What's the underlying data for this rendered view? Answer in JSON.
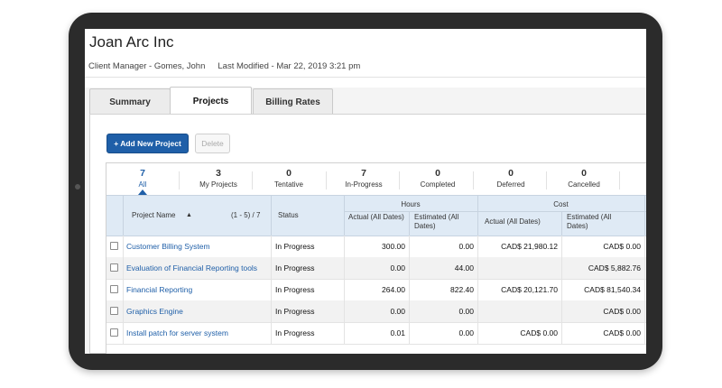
{
  "page": {
    "title": "Joan Arc Inc",
    "client_manager": "Client Manager - Gomes, John",
    "last_modified": "Last Modified - Mar 22, 2019 3:21 pm"
  },
  "tabs": [
    {
      "label": "Summary",
      "active": false
    },
    {
      "label": "Projects",
      "active": true
    },
    {
      "label": "Billing Rates",
      "active": false
    }
  ],
  "toolbar": {
    "add_label": "+ Add New Project",
    "delete_label": "Delete"
  },
  "filters": [
    {
      "count": "7",
      "label": "All",
      "active": true
    },
    {
      "count": "3",
      "label": "My Projects"
    },
    {
      "count": "0",
      "label": "Tentative"
    },
    {
      "count": "7",
      "label": "In-Progress"
    },
    {
      "count": "0",
      "label": "Completed"
    },
    {
      "count": "0",
      "label": "Deferred"
    },
    {
      "count": "0",
      "label": "Cancelled"
    }
  ],
  "table": {
    "project_name_header": "Project Name",
    "sort_indicator": "▲",
    "range": "(1 - 5) / 7",
    "status_header": "Status",
    "hours_header": "Hours",
    "cost_header": "Cost",
    "actual_all_dates": "Actual (All Dates)",
    "estimated_all_dates": "Estimated (All Dates)",
    "rows": [
      {
        "name": "Customer Billing System",
        "status": "In Progress",
        "hours_actual": "300.00",
        "hours_est": "0.00",
        "cost_actual": "CAD$ 21,980.12",
        "cost_est": "CAD$ 0.00"
      },
      {
        "name": "Evaluation of Financial Reporting tools",
        "status": "In Progress",
        "hours_actual": "0.00",
        "hours_est": "44.00",
        "cost_actual": "",
        "cost_est": "CAD$ 5,882.76"
      },
      {
        "name": "Financial Reporting",
        "status": "In Progress",
        "hours_actual": "264.00",
        "hours_est": "822.40",
        "cost_actual": "CAD$ 20,121.70",
        "cost_est": "CAD$ 81,540.34"
      },
      {
        "name": "Graphics Engine",
        "status": "In Progress",
        "hours_actual": "0.00",
        "hours_est": "0.00",
        "cost_actual": "",
        "cost_est": "CAD$ 0.00"
      },
      {
        "name": "Install patch for server system",
        "status": "In Progress",
        "hours_actual": "0.01",
        "hours_est": "0.00",
        "cost_actual": "CAD$ 0.00",
        "cost_est": "CAD$ 0.00"
      }
    ]
  },
  "colors": {
    "accent": "#1f5fa8",
    "header_band": "#dfeaf5",
    "tablet_frame": "#2b2b2b"
  }
}
